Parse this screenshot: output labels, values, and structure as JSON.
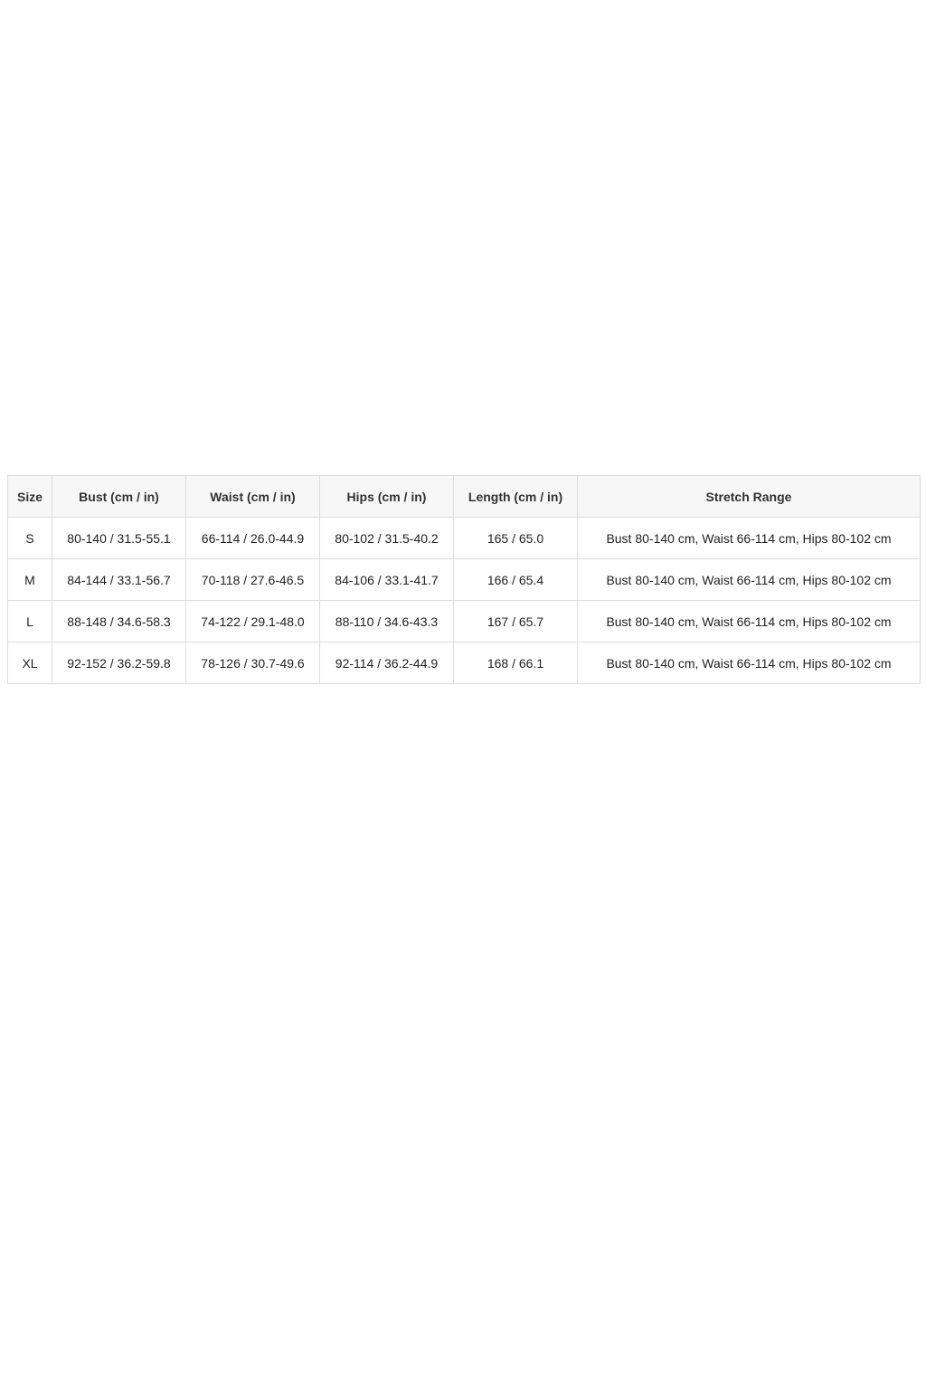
{
  "size_chart": {
    "headers": [
      "Size",
      "Bust (cm / in)",
      "Waist (cm / in)",
      "Hips (cm / in)",
      "Length (cm / in)",
      "Stretch Range"
    ],
    "rows": [
      [
        "S",
        "80-140 / 31.5-55.1",
        "66-114 / 26.0-44.9",
        "80-102 / 31.5-40.2",
        "165 / 65.0",
        "Bust 80-140 cm, Waist 66-114 cm, Hips 80-102 cm"
      ],
      [
        "M",
        "84-144 / 33.1-56.7",
        "70-118 / 27.6-46.5",
        "84-106 / 33.1-41.7",
        "166 / 65.4",
        "Bust 80-140 cm, Waist 66-114 cm, Hips 80-102 cm"
      ],
      [
        "L",
        "88-148 / 34.6-58.3",
        "74-122 / 29.1-48.0",
        "88-110 / 34.6-43.3",
        "167 / 65.7",
        "Bust 80-140 cm, Waist 66-114 cm, Hips 80-102 cm"
      ],
      [
        "XL",
        "92-152 / 36.2-59.8",
        "78-126 / 30.7-49.6",
        "92-114 / 36.2-44.9",
        "168 / 66.1",
        "Bust 80-140 cm, Waist 66-114 cm, Hips 80-102 cm"
      ]
    ]
  },
  "colors": {
    "header_background": "#f7f7f7",
    "border": "#dddddd",
    "text": "#222222"
  }
}
